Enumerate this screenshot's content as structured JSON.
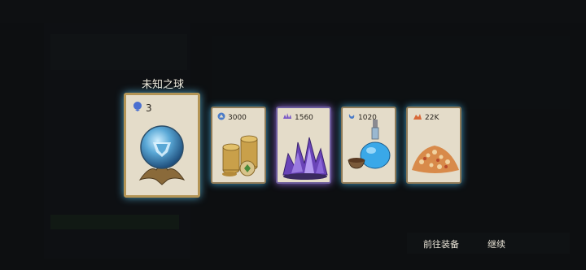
{
  "popup": {
    "title": "未知之球"
  },
  "rewards": [
    {
      "name": "unknown-orb",
      "count": "3",
      "icon": "orb-badge-icon",
      "glow": "#5ac0e8"
    },
    {
      "name": "coins",
      "count": "3000",
      "icon": "coin-icon",
      "glow": "#4fb4e4"
    },
    {
      "name": "crystals",
      "count": "1560",
      "icon": "crystal-icon",
      "glow": "#8f6ee0"
    },
    {
      "name": "potion",
      "count": "1020",
      "icon": "potion-icon",
      "glow": "#4fb4e4"
    },
    {
      "name": "material",
      "count": "22K",
      "icon": "material-icon",
      "glow": "#4fb4e4"
    }
  ],
  "buttons": {
    "go_equip": "前往装备",
    "continue": "继续"
  }
}
